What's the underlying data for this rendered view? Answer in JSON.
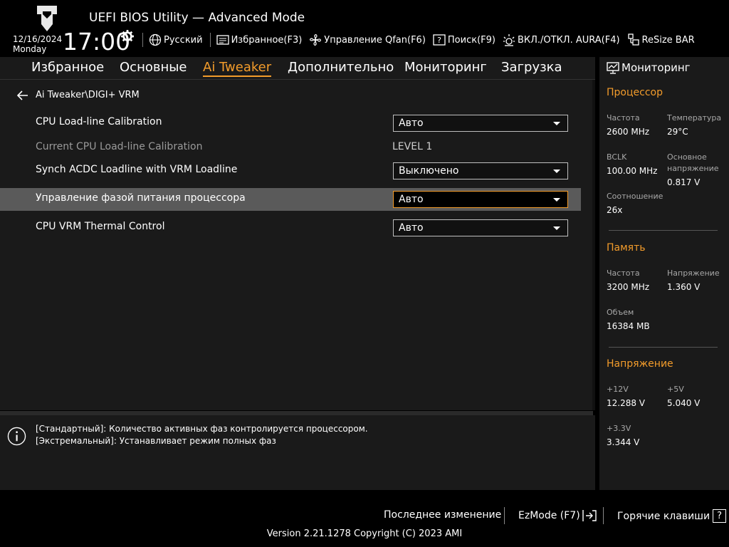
{
  "header": {
    "title": "UEFI BIOS Utility — Advanced Mode",
    "date": "12/16/2024",
    "weekday": "Monday",
    "time": "17:00",
    "toolbar": {
      "language": "Русский",
      "favorites": "Избранное(F3)",
      "qfan": "Управление Qfan(F6)",
      "search": "Поиск(F9)",
      "aura": "ВКЛ./ОТКЛ. AURA(F4)",
      "resize_bar": "ReSize BAR"
    }
  },
  "nav": {
    "tabs": [
      "Избранное",
      "Основные",
      "Ai Tweaker",
      "Дополнительно",
      "Мониторинг",
      "Загрузка"
    ],
    "active": "Ai Tweaker"
  },
  "main": {
    "breadcrumb": "Ai Tweaker\\DIGI+ VRM",
    "rows": [
      {
        "label": "CPU Load-line Calibration",
        "value": "Авто"
      },
      {
        "label": "Current CPU Load-line Calibration",
        "value": "LEVEL 1"
      },
      {
        "label": "Synch ACDC Loadline with VRM Loadline",
        "value": "Выключено"
      },
      {
        "label": "Управление фазой питания процессора",
        "value": "Авто"
      },
      {
        "label": "CPU VRM Thermal Control",
        "value": "Авто"
      }
    ]
  },
  "help": {
    "lines": [
      "[Стандартный]: Количество активных фаз контролируется процессором.",
      "[Экстремальный]: Устанавливает режим полных фаз"
    ]
  },
  "monitor": {
    "title": "Мониторинг",
    "cpu": {
      "section": "Процессор",
      "freq_label": "Частота",
      "freq": "2600 MHz",
      "temp_label": "Температура",
      "temp": "29°C",
      "bclk_label": "BCLK",
      "bclk": "100.00 MHz",
      "core_v_label_1": "Основное",
      "core_v_label_2": "напряжение",
      "core_v": "0.817 V",
      "ratio_label": "Соотношение",
      "ratio": "26x"
    },
    "memory": {
      "section": "Память",
      "freq_label": "Частота",
      "freq": "3200 MHz",
      "volt_label": "Напряжение",
      "volt": "1.360 V",
      "size_label": "Объем",
      "size": "16384 MB"
    },
    "voltage": {
      "section": "Напряжение",
      "v12_label": "+12V",
      "v12": "12.288 V",
      "v5_label": "+5V",
      "v5": "5.040 V",
      "v33_label": "+3.3V",
      "v33": "3.344 V"
    }
  },
  "footer": {
    "last_modified": "Последнее изменение",
    "ezmode": "EzMode (F7)",
    "hotkeys": "Горячие клавиши",
    "hotkeys_key": "?",
    "version": "Version 2.21.1278 Copyright (C) 2023 AMI"
  },
  "colors": {
    "accent": "#f39c2b",
    "panel": "#1a1a1a",
    "highlight": "#5a5a5a"
  }
}
